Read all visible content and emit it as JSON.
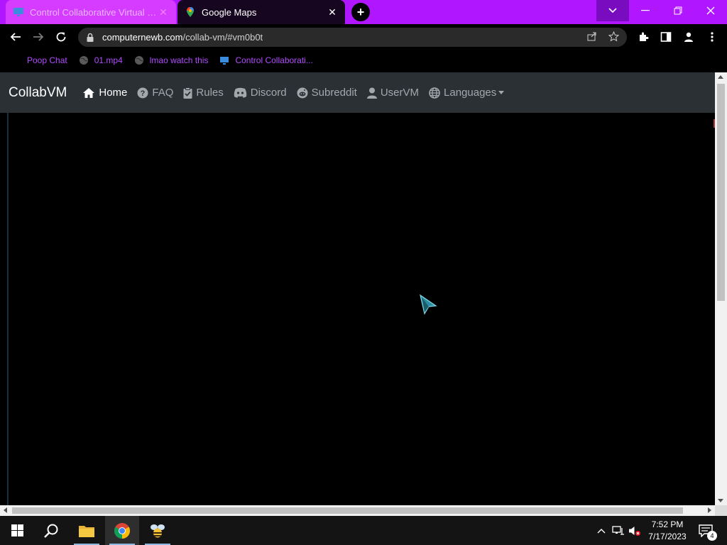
{
  "browser": {
    "tabs": [
      {
        "title": "Control Collaborative Virtual M...",
        "active": true,
        "favicon": "monitor-icon"
      },
      {
        "title": "Google Maps",
        "active": false,
        "favicon": "maps-pin-icon"
      }
    ],
    "new_tab": "+",
    "window_controls": {
      "dropdown": "⌄",
      "minimize": "—",
      "restore": "❐",
      "close": "✕"
    },
    "url": {
      "domain": "computernewb.com",
      "path": "/collab-vm/#vm0b0t"
    },
    "bookmarks": [
      {
        "label": "Poop Chat",
        "icon": ""
      },
      {
        "label": "01.mp4",
        "icon": "globe-icon"
      },
      {
        "label": "lmao watch this",
        "icon": "globe-icon"
      },
      {
        "label": "Control Collaborati...",
        "icon": "monitor-icon"
      }
    ]
  },
  "site": {
    "brand": "CollabVM",
    "nav": [
      {
        "label": "Home",
        "icon": "home-icon",
        "active": true
      },
      {
        "label": "FAQ",
        "icon": "question-circle-icon",
        "active": false
      },
      {
        "label": "Rules",
        "icon": "clipboard-check-icon",
        "active": false
      },
      {
        "label": "Discord",
        "icon": "discord-icon",
        "active": false
      },
      {
        "label": "Subreddit",
        "icon": "reddit-icon",
        "active": false
      },
      {
        "label": "UserVM",
        "icon": "user-icon",
        "active": false
      },
      {
        "label": "Languages",
        "icon": "globe-icon",
        "active": false,
        "dropdown": true
      }
    ]
  },
  "taskbar": {
    "clock_time": "7:52 PM",
    "clock_date": "7/17/2023",
    "notification_count": "4",
    "apps": [
      "start-icon",
      "search-icon",
      "file-explorer-icon",
      "chrome-icon",
      "bee-app-icon"
    ]
  },
  "colors": {
    "tabstrip": "#b016ff",
    "active_tab": "#d53cff",
    "bookmark_text": "#b24bff",
    "navbar": "#2b3035"
  }
}
